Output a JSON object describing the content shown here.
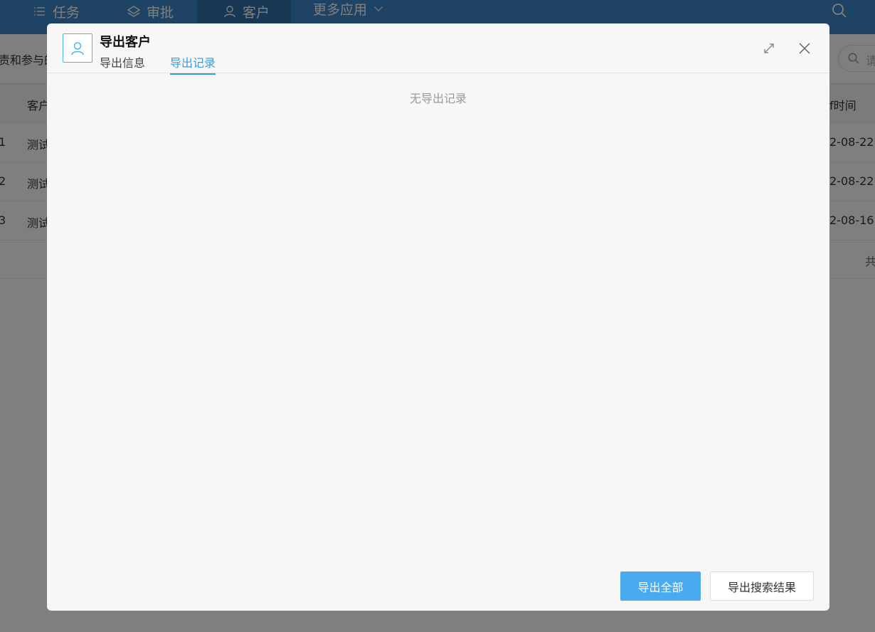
{
  "nav": {
    "items": [
      {
        "label": "任务",
        "icon": "list-icon"
      },
      {
        "label": "审批",
        "icon": "layers-icon"
      },
      {
        "label": "客户",
        "icon": "user-icon",
        "active": true
      },
      {
        "label": "更多应用",
        "icon": "chevron-down-icon"
      }
    ]
  },
  "subbar": {
    "label": "责和参与的",
    "search_placeholder": "请"
  },
  "table": {
    "header": {
      "idx": "",
      "name": "客户",
      "time": "f时间"
    },
    "rows": [
      {
        "idx": "1",
        "name": "测试",
        "time": "2-08-22"
      },
      {
        "idx": "2",
        "name": "测试",
        "time": "2-08-22"
      },
      {
        "idx": "3",
        "name": "测试",
        "time": "2-08-16"
      }
    ],
    "footer": "共"
  },
  "modal": {
    "title": "导出客户",
    "tabs": [
      {
        "label": "导出信息",
        "active": false
      },
      {
        "label": "导出记录",
        "active": true
      }
    ],
    "empty_text": "无导出记录",
    "buttons": {
      "export_all": "导出全部",
      "export_search": "导出搜索结果"
    }
  },
  "colors": {
    "nav_bg": "#3f86c9",
    "nav_active": "#2f6ea8",
    "accent": "#3c9be0",
    "primary_button": "#49aaf0"
  }
}
